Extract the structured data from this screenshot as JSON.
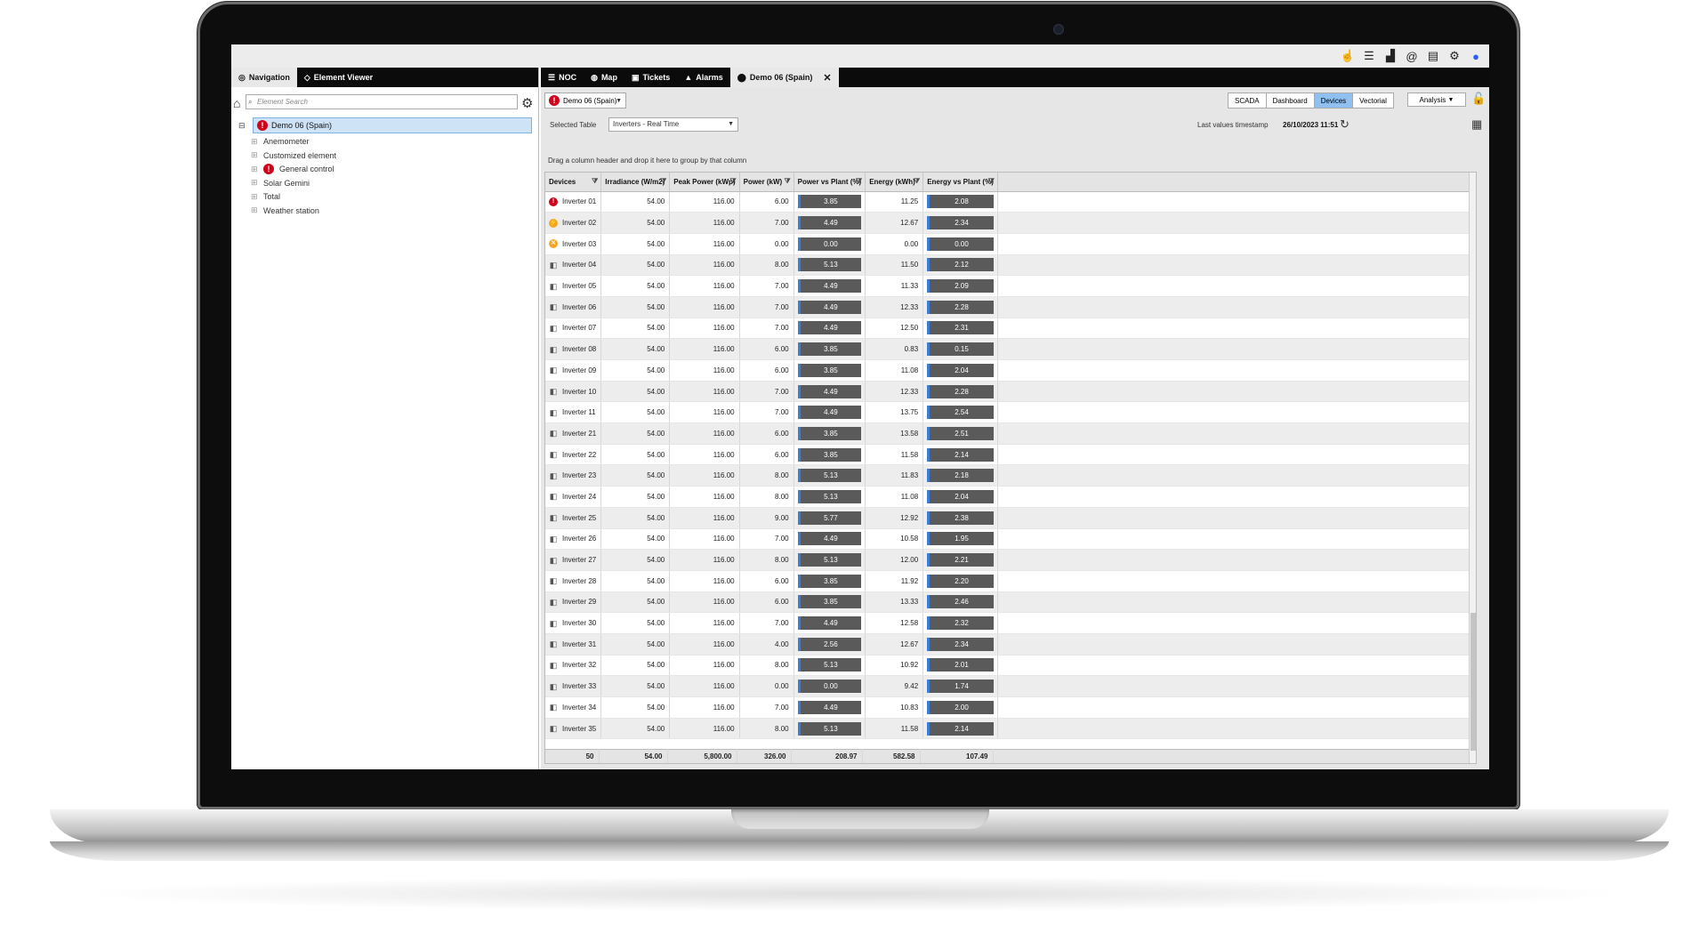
{
  "topbar": {
    "icons": [
      "hand-pointer-icon",
      "database-icon",
      "area-chart-icon",
      "at-icon",
      "document-icon",
      "gear-icon",
      "user-icon"
    ]
  },
  "left_panel": {
    "tabs": [
      {
        "label": "Navigation",
        "icon": "compass-icon",
        "active": true
      },
      {
        "label": "Element Viewer",
        "icon": "cube-icon",
        "active": false
      }
    ],
    "search_placeholder": "Element Search",
    "tree": {
      "root": "Demo 06 (Spain)",
      "items": [
        {
          "label": "Anemometer",
          "status": "none"
        },
        {
          "label": "Customized element",
          "status": "none"
        },
        {
          "label": "General control",
          "status": "alarm"
        },
        {
          "label": "Solar Gemini",
          "status": "none"
        },
        {
          "label": "Total",
          "status": "none"
        },
        {
          "label": "Weather station",
          "status": "none"
        }
      ]
    }
  },
  "right_panel": {
    "tabs": [
      {
        "label": "NOC",
        "icon": "list-icon"
      },
      {
        "label": "Map",
        "icon": "globe-icon"
      },
      {
        "label": "Tickets",
        "icon": "clipboard-icon"
      },
      {
        "label": "Alarms",
        "icon": "warning-icon"
      },
      {
        "label": "Demo 06 (Spain)",
        "icon": "map-pin-icon",
        "active": true
      }
    ],
    "plant_select": "Demo 06 (Spain)",
    "views": [
      "SCADA",
      "Dashboard",
      "Devices",
      "Vectorial"
    ],
    "active_view": "Devices",
    "analysis_label": "Analysis",
    "selected_table_label": "Selected Table",
    "selected_table_value": "Inverters - Real Time",
    "timestamp_label": "Last values timestamp",
    "timestamp_value": "26/10/2023 11:51",
    "group_hint": "Drag a column header and drop it here to group by that column",
    "grid": {
      "columns": [
        "Devices",
        "Irradiance (W/m2)",
        "Peak Power (kWp)",
        "Power (kW)",
        "Power vs Plant (%)",
        "Energy (kWh)",
        "Energy vs Plant (%)"
      ],
      "rows": [
        {
          "device": "Inverter 01",
          "status": "alarm",
          "irr": "54.00",
          "peak": "116.00",
          "power": "6.00",
          "pvp": "3.85",
          "energy": "11.25",
          "evp": "2.08"
        },
        {
          "device": "Inverter 02",
          "status": "warn",
          "irr": "54.00",
          "peak": "116.00",
          "power": "7.00",
          "pvp": "4.49",
          "energy": "12.67",
          "evp": "2.34"
        },
        {
          "device": "Inverter 03",
          "status": "warn-x",
          "irr": "54.00",
          "peak": "116.00",
          "power": "0.00",
          "pvp": "0.00",
          "energy": "0.00",
          "evp": "0.00"
        },
        {
          "device": "Inverter 04",
          "status": "ok",
          "irr": "54.00",
          "peak": "116.00",
          "power": "8.00",
          "pvp": "5.13",
          "energy": "11.50",
          "evp": "2.12"
        },
        {
          "device": "Inverter 05",
          "status": "ok",
          "irr": "54.00",
          "peak": "116.00",
          "power": "7.00",
          "pvp": "4.49",
          "energy": "11.33",
          "evp": "2.09"
        },
        {
          "device": "Inverter 06",
          "status": "ok",
          "irr": "54.00",
          "peak": "116.00",
          "power": "7.00",
          "pvp": "4.49",
          "energy": "12.33",
          "evp": "2.28"
        },
        {
          "device": "Inverter 07",
          "status": "ok",
          "irr": "54.00",
          "peak": "116.00",
          "power": "7.00",
          "pvp": "4.49",
          "energy": "12.50",
          "evp": "2.31"
        },
        {
          "device": "Inverter 08",
          "status": "ok",
          "irr": "54.00",
          "peak": "116.00",
          "power": "6.00",
          "pvp": "3.85",
          "energy": "0.83",
          "evp": "0.15"
        },
        {
          "device": "Inverter 09",
          "status": "ok",
          "irr": "54.00",
          "peak": "116.00",
          "power": "6.00",
          "pvp": "3.85",
          "energy": "11.08",
          "evp": "2.04"
        },
        {
          "device": "Inverter 10",
          "status": "ok",
          "irr": "54.00",
          "peak": "116.00",
          "power": "7.00",
          "pvp": "4.49",
          "energy": "12.33",
          "evp": "2.28"
        },
        {
          "device": "Inverter 11",
          "status": "ok",
          "irr": "54.00",
          "peak": "116.00",
          "power": "7.00",
          "pvp": "4.49",
          "energy": "13.75",
          "evp": "2.54"
        },
        {
          "device": "Inverter 21",
          "status": "ok",
          "irr": "54.00",
          "peak": "116.00",
          "power": "6.00",
          "pvp": "3.85",
          "energy": "13.58",
          "evp": "2.51"
        },
        {
          "device": "Inverter 22",
          "status": "ok",
          "irr": "54.00",
          "peak": "116.00",
          "power": "6.00",
          "pvp": "3.85",
          "energy": "11.58",
          "evp": "2.14"
        },
        {
          "device": "Inverter 23",
          "status": "ok",
          "irr": "54.00",
          "peak": "116.00",
          "power": "8.00",
          "pvp": "5.13",
          "energy": "11.83",
          "evp": "2.18"
        },
        {
          "device": "Inverter 24",
          "status": "ok",
          "irr": "54.00",
          "peak": "116.00",
          "power": "8.00",
          "pvp": "5.13",
          "energy": "11.08",
          "evp": "2.04"
        },
        {
          "device": "Inverter 25",
          "status": "ok",
          "irr": "54.00",
          "peak": "116.00",
          "power": "9.00",
          "pvp": "5.77",
          "energy": "12.92",
          "evp": "2.38"
        },
        {
          "device": "Inverter 26",
          "status": "ok",
          "irr": "54.00",
          "peak": "116.00",
          "power": "7.00",
          "pvp": "4.49",
          "energy": "10.58",
          "evp": "1.95"
        },
        {
          "device": "Inverter 27",
          "status": "ok",
          "irr": "54.00",
          "peak": "116.00",
          "power": "8.00",
          "pvp": "5.13",
          "energy": "12.00",
          "evp": "2.21"
        },
        {
          "device": "Inverter 28",
          "status": "ok",
          "irr": "54.00",
          "peak": "116.00",
          "power": "6.00",
          "pvp": "3.85",
          "energy": "11.92",
          "evp": "2.20"
        },
        {
          "device": "Inverter 29",
          "status": "ok",
          "irr": "54.00",
          "peak": "116.00",
          "power": "6.00",
          "pvp": "3.85",
          "energy": "13.33",
          "evp": "2.46"
        },
        {
          "device": "Inverter 30",
          "status": "ok",
          "irr": "54.00",
          "peak": "116.00",
          "power": "7.00",
          "pvp": "4.49",
          "energy": "12.58",
          "evp": "2.32"
        },
        {
          "device": "Inverter 31",
          "status": "ok",
          "irr": "54.00",
          "peak": "116.00",
          "power": "4.00",
          "pvp": "2.56",
          "energy": "12.67",
          "evp": "2.34"
        },
        {
          "device": "Inverter 32",
          "status": "ok",
          "irr": "54.00",
          "peak": "116.00",
          "power": "8.00",
          "pvp": "5.13",
          "energy": "10.92",
          "evp": "2.01"
        },
        {
          "device": "Inverter 33",
          "status": "ok",
          "irr": "54.00",
          "peak": "116.00",
          "power": "0.00",
          "pvp": "0.00",
          "energy": "9.42",
          "evp": "1.74"
        },
        {
          "device": "Inverter 34",
          "status": "ok",
          "irr": "54.00",
          "peak": "116.00",
          "power": "7.00",
          "pvp": "4.49",
          "energy": "10.83",
          "evp": "2.00"
        },
        {
          "device": "Inverter 35",
          "status": "ok",
          "irr": "54.00",
          "peak": "116.00",
          "power": "8.00",
          "pvp": "5.13",
          "energy": "11.58",
          "evp": "2.14"
        }
      ],
      "totals": {
        "device": "50",
        "irr": "54.00",
        "peak": "5,800.00",
        "power": "326.00",
        "pvp": "208.97",
        "energy": "582.58",
        "evp": "107.49"
      }
    }
  }
}
